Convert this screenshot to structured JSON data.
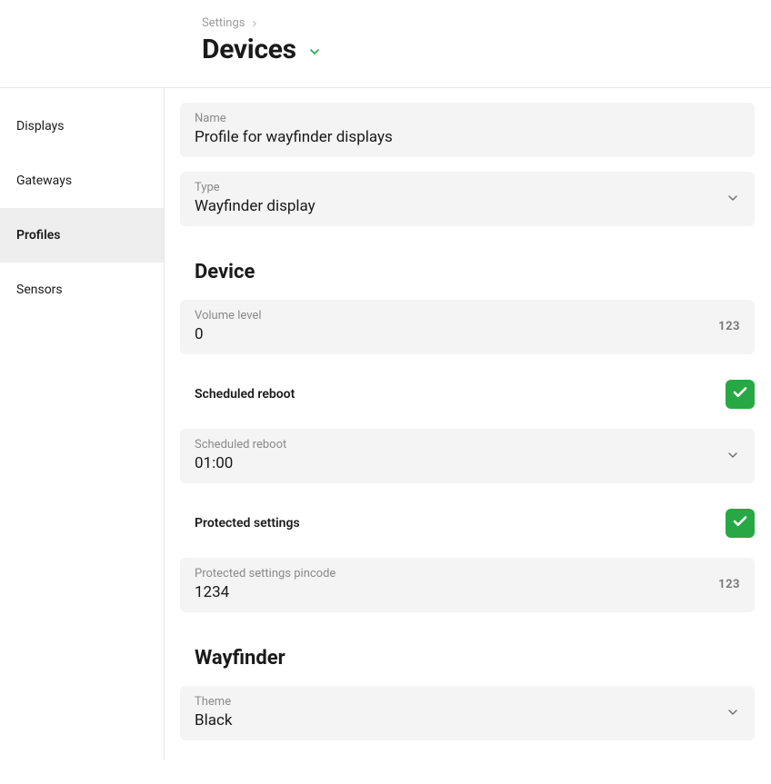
{
  "breadcrumb": {
    "parent": "Settings"
  },
  "page": {
    "title": "Devices"
  },
  "sidebar": {
    "items": [
      {
        "label": "Displays"
      },
      {
        "label": "Gateways"
      },
      {
        "label": "Profiles"
      },
      {
        "label": "Sensors"
      }
    ]
  },
  "fields": {
    "name": {
      "label": "Name",
      "value": "Profile for wayfinder displays"
    },
    "type": {
      "label": "Type",
      "value": "Wayfinder display"
    }
  },
  "sections": {
    "device": {
      "title": "Device",
      "volume": {
        "label": "Volume level",
        "value": "0",
        "hint": "123"
      },
      "scheduled_reboot_toggle": {
        "label": "Scheduled reboot"
      },
      "scheduled_reboot_time": {
        "label": "Scheduled reboot",
        "value": "01:00"
      },
      "protected_settings_toggle": {
        "label": "Protected settings"
      },
      "protected_settings_pin": {
        "label": "Protected settings pincode",
        "value": "1234",
        "hint": "123"
      }
    },
    "wayfinder": {
      "title": "Wayfinder",
      "theme": {
        "label": "Theme",
        "value": "Black"
      }
    }
  }
}
